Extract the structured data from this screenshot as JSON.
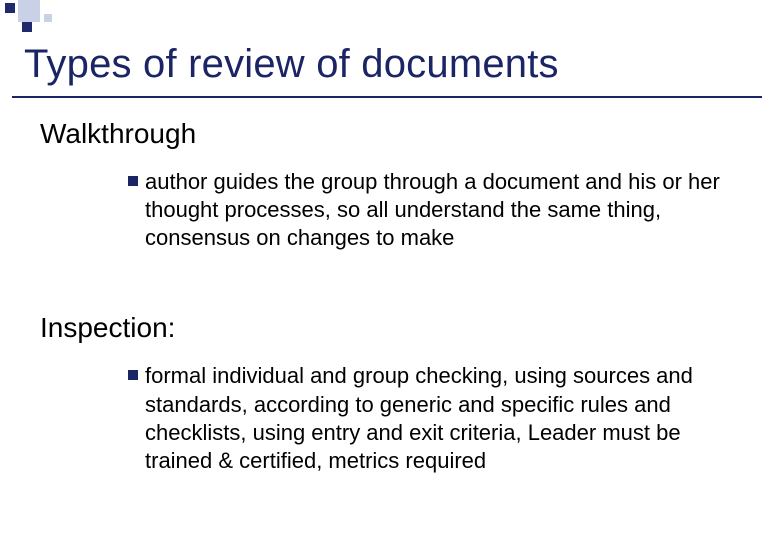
{
  "slide": {
    "title": "Types of review of documents",
    "sections": [
      {
        "heading": "Walkthrough",
        "bullet": "author guides the group through a document and his or her thought processes, so all understand the same thing, consensus on changes to make"
      },
      {
        "heading": "Inspection:",
        "bullet": "formal individual and group checking, using sources and standards, according to generic and specific rules and checklists, using entry and exit criteria, Leader must be trained & certified, metrics required"
      }
    ]
  }
}
